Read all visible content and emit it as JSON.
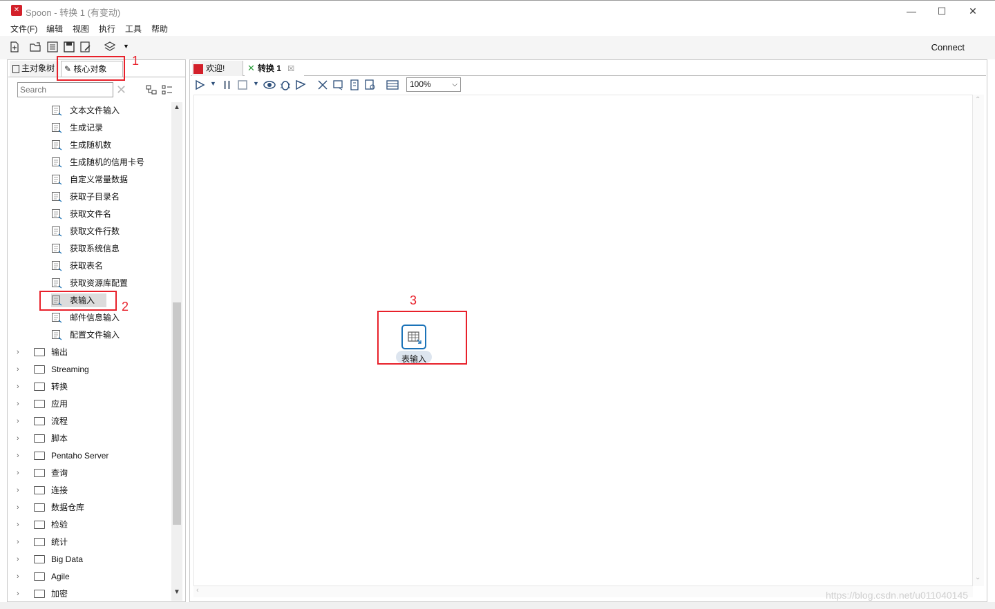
{
  "window": {
    "title": "Spoon - 转换 1 (有变动)",
    "minimize": "—",
    "maximize": "☐",
    "close": "✕"
  },
  "menu": [
    "文件(F)",
    "编辑",
    "视图",
    "执行",
    "工具",
    "帮助"
  ],
  "toolbar": {
    "connect_label": "Connect",
    "icons": [
      "new-file-icon",
      "open-file-icon",
      "explore-repository-icon",
      "save-icon",
      "save-as-icon",
      "layers-icon"
    ]
  },
  "left": {
    "tabs": [
      "主对象树",
      "核心对象"
    ],
    "search_placeholder": "Search",
    "tree_leaves": [
      "文本文件输入",
      "生成记录",
      "生成随机数",
      "生成随机的信用卡号",
      "自定义常量数据",
      "获取子目录名",
      "获取文件名",
      "获取文件行数",
      "获取系统信息",
      "获取表名",
      "获取资源库配置",
      "表输入",
      "邮件信息输入",
      "配置文件输入"
    ],
    "selected_leaf": "表输入",
    "tree_folders": [
      "输出",
      "Streaming",
      "转换",
      "应用",
      "流程",
      "脚本",
      "Pentaho Server",
      "查询",
      "连接",
      "数据仓库",
      "检验",
      "统计",
      "Big Data",
      "Agile",
      "加密"
    ]
  },
  "right": {
    "tabs": [
      "欢迎!",
      "转换 1"
    ],
    "zoom": "100%",
    "canvas_step": {
      "label": "表输入"
    }
  },
  "annotations": {
    "one": "1",
    "two": "2",
    "three": "3"
  },
  "watermark": "https://blog.csdn.net/u011040145",
  "colors": {
    "accent": "#1b73b8",
    "annotation": "#e8202a",
    "brand": "#d3202a"
  }
}
